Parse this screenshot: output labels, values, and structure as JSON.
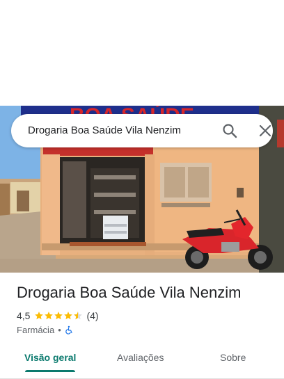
{
  "search": {
    "query": "Drogaria Boa Saúde Vila Nenzim"
  },
  "photo": {
    "sign_text": "BOA SAÚDE"
  },
  "place": {
    "name": "Drogaria Boa Saúde Vila Nenzim",
    "rating": "4,5",
    "stars": 4.5,
    "review_count": "(4)",
    "category": "Farmácia",
    "separator": "•"
  },
  "tabs": [
    {
      "label": "Visão geral",
      "active": true
    },
    {
      "label": "Avaliações",
      "active": false
    },
    {
      "label": "Sobre",
      "active": false
    }
  ],
  "colors": {
    "accent": "#0b7a6e",
    "star": "#fbbc04",
    "wheelchair": "#1a73e8"
  }
}
